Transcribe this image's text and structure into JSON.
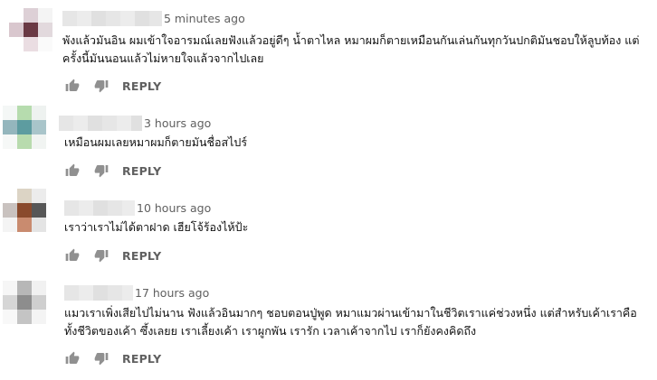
{
  "comments": [
    {
      "time": "5 minutes ago",
      "text": "พังแล้วมันอิน ผมเข้าใจอารมณ์เลยฟังแล้วอยู่ดีๆ น้ำตาไหล   หมาผมก็ตายเหมือนกันเล่นกันทุกวันปกติมันชอบให้ลูบท้อง แต่ครั้งนี้มันนอนแล้วไม่หายใจแล้วจากไปเลย",
      "reply_label": "REPLY",
      "avatar_colors": [
        "#ffffff",
        "#ddd0d6",
        "#f4f4f4",
        "#d9c7ce",
        "#6a3944",
        "#e2d9dd",
        "#ffffff",
        "#eadde2",
        "#fafafa"
      ]
    },
    {
      "time": "3 hours ago",
      "text": "เหมือนผมเลยหมาผมก็ตายมันชื่อสไปร์",
      "reply_label": "REPLY",
      "avatar_colors": [
        "#f4f7f6",
        "#b6dcae",
        "#eef2f0",
        "#94b6bd",
        "#5d9ca0",
        "#a9c5ca",
        "#f6f8f7",
        "#b8dbae",
        "#f1f4f2"
      ]
    },
    {
      "time": "10 hours ago",
      "text": "เราว่าเราไม่ได้ตาฝาด เฮียโจ้ร้องไห้ป้ะ",
      "reply_label": "REPLY",
      "avatar_colors": [
        "#ffffff",
        "#dcd4c5",
        "#ececec",
        "#c9c2bf",
        "#8a4a2c",
        "#575757",
        "#f4f4f4",
        "#c98b6f",
        "#e4e4e4"
      ]
    },
    {
      "time": "17 hours ago",
      "text": "แมวเราเพิ่งเสียไปไม่นาน ฟังแล้วอินมากๆ ชอบตอนปู่พูด หมาแมวผ่านเข้ามาในชีวิตเราแค่ช่วงหนึ่ง แต่สำหรับเค้าเราคือทั้งชีวิตของเค้า ซึ้งเลยย เราเลี้ยงเค้า เราผูกพัน เรารัก เวลาเค้าจากไป เราก็ยังคงคิดถึง",
      "reply_label": "REPLY",
      "avatar_colors": [
        "#f6f6f6",
        "#b7b7b7",
        "#f1f1f1",
        "#d6d6d6",
        "#8d8d8d",
        "#cfcfcf",
        "#f8f8f8",
        "#c4c4c4",
        "#f4f4f4"
      ]
    }
  ]
}
